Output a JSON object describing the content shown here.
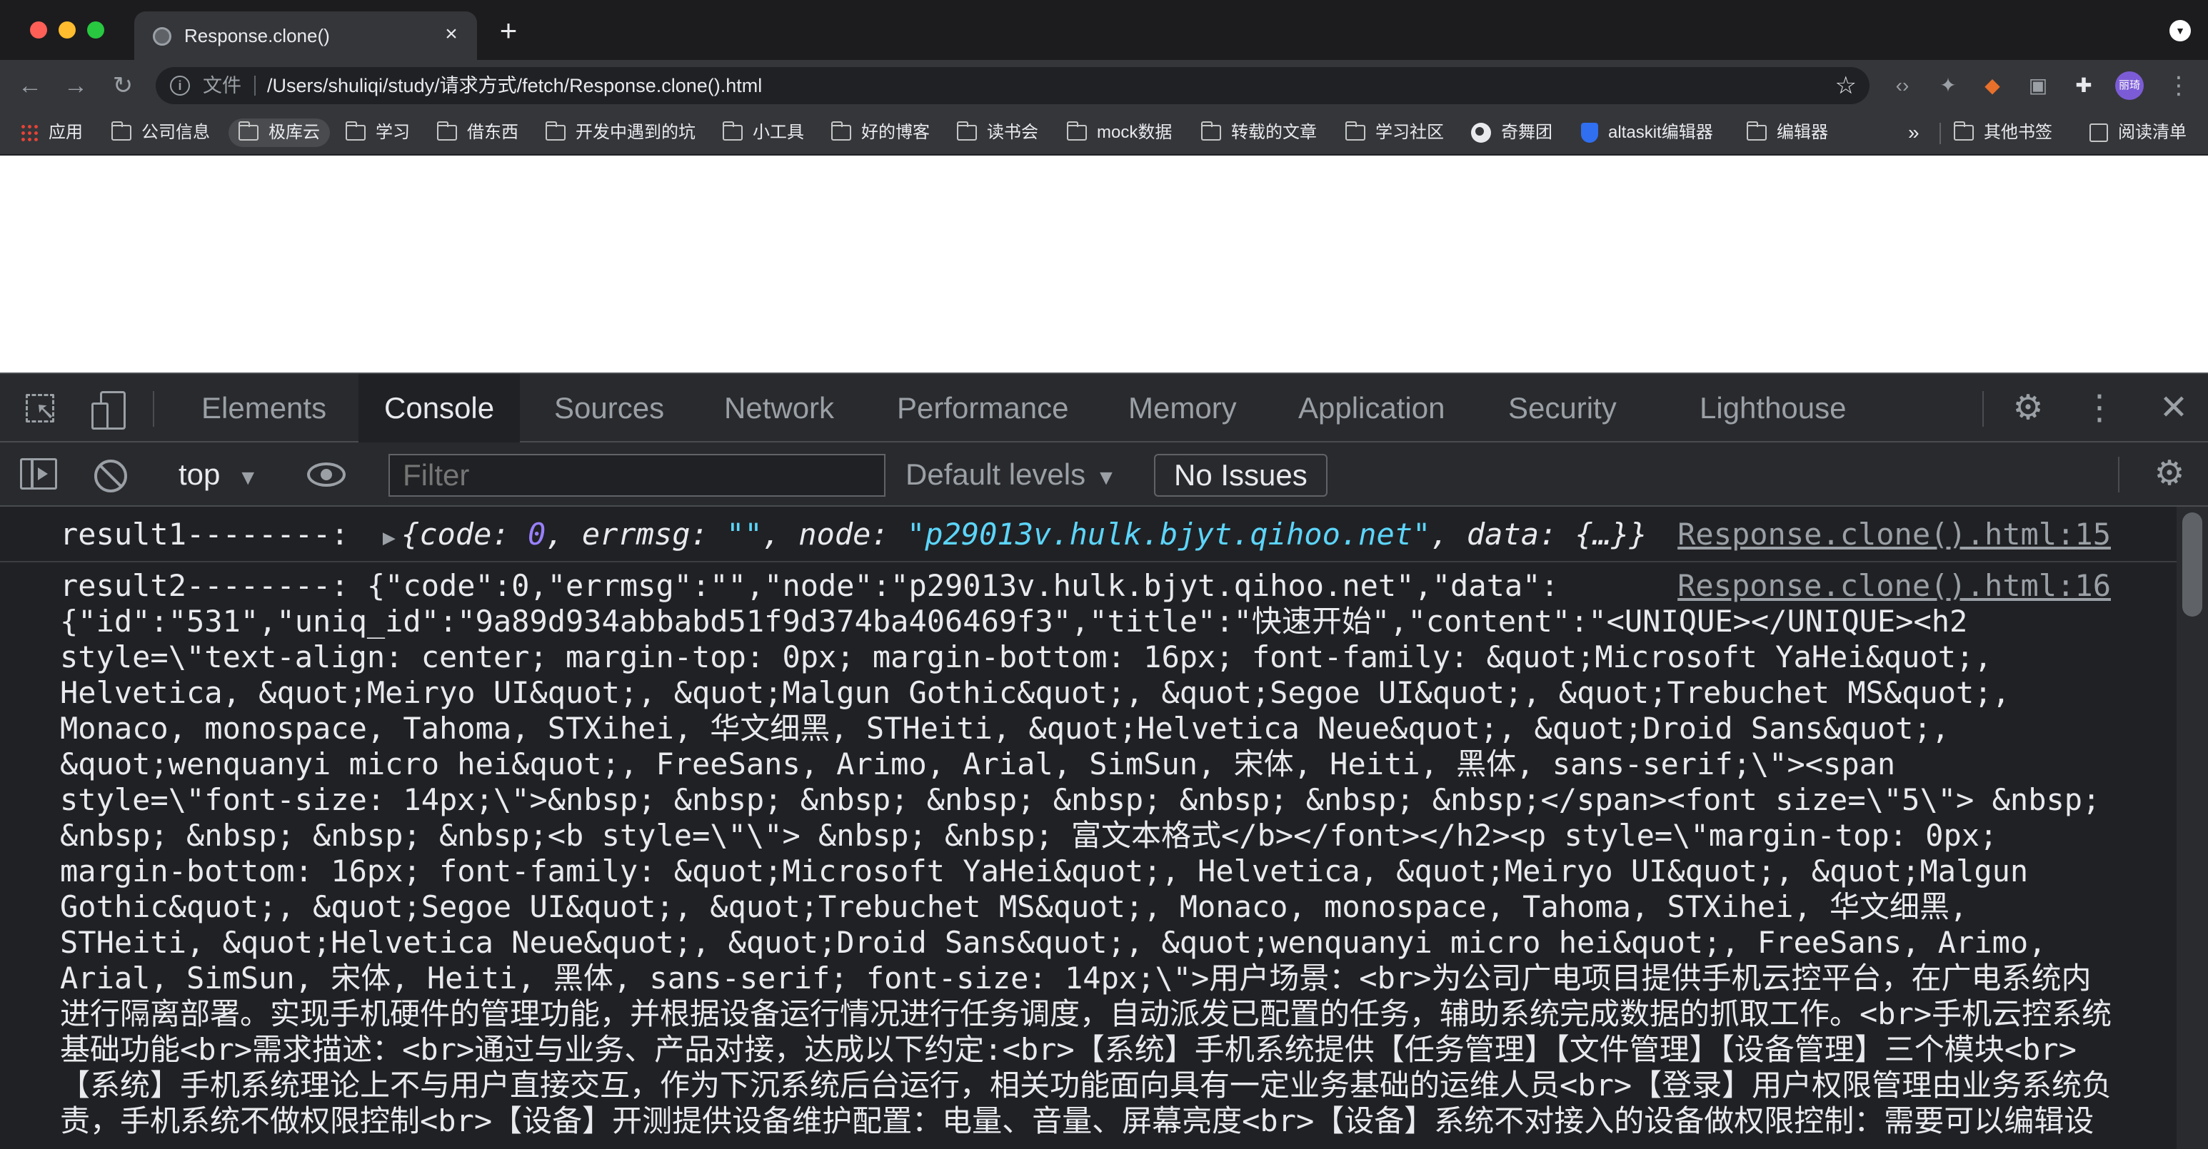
{
  "browser": {
    "tab_title": "Response.clone()",
    "omnibox_file_label": "文件",
    "url": "/Users/shuliqi/study/请求方式/fetch/Response.clone().html",
    "profile_initials": "丽琦"
  },
  "bookmarks": {
    "items": [
      {
        "label": "应用",
        "icon": "apps-grid-icon"
      },
      {
        "label": "公司信息",
        "icon": "folder-icon"
      },
      {
        "label": "极库云",
        "icon": "folder-icon"
      },
      {
        "label": "学习",
        "icon": "folder-icon"
      },
      {
        "label": "借东西",
        "icon": "folder-icon"
      },
      {
        "label": "开发中遇到的坑",
        "icon": "folder-icon"
      },
      {
        "label": "小工具",
        "icon": "folder-icon"
      },
      {
        "label": "好的博客",
        "icon": "folder-icon"
      },
      {
        "label": "读书会",
        "icon": "folder-icon"
      },
      {
        "label": "mock数据",
        "icon": "folder-icon"
      },
      {
        "label": "转载的文章",
        "icon": "folder-icon"
      },
      {
        "label": "学习社区",
        "icon": "folder-icon"
      },
      {
        "label": "奇舞团",
        "icon": "globe-icon"
      },
      {
        "label": "altaskit编辑器",
        "icon": "shield-icon"
      },
      {
        "label": "编辑器",
        "icon": "folder-icon"
      }
    ],
    "more": "»",
    "other_bookmarks": "其他书签",
    "reading_list": "阅读清单"
  },
  "devtools": {
    "tabs": [
      "Elements",
      "Console",
      "Sources",
      "Network",
      "Performance",
      "Memory",
      "Application",
      "Security",
      "Lighthouse"
    ],
    "active_tab": "Console",
    "context": "top",
    "filter_placeholder": "Filter",
    "levels": "Default levels",
    "issues": "No Issues"
  },
  "console": {
    "row1": {
      "label": "result1--------: ",
      "obj_open": "{",
      "code_key": "code: ",
      "code_val": "0",
      "errmsg_key": ", errmsg: ",
      "errmsg_val": "\"\"",
      "node_key": ", node: ",
      "node_val": "\"p29013v.hulk.bjyt.qihoo.net\"",
      "data_key": ", data: ",
      "data_val": "{…}}",
      "source": "Response.clone().html:15"
    },
    "row2": {
      "text": "result2--------: {\"code\":0,\"errmsg\":\"\",\"node\":\"p29013v.hulk.bjyt.qihoo.net\",\"data\":\n{\"id\":\"531\",\"uniq_id\":\"9a89d934abbabd51f9d374ba406469f3\",\"title\":\"快速开始\",\"content\":\"<UNIQUE></UNIQUE><h2\nstyle=\\\"text-align: center; margin-top: 0px; margin-bottom: 16px; font-family: &quot;Microsoft YaHei&quot;,\nHelvetica, &quot;Meiryo UI&quot;, &quot;Malgun Gothic&quot;, &quot;Segoe UI&quot;, &quot;Trebuchet MS&quot;,\nMonaco, monospace, Tahoma, STXihei, 华文细黑, STHeiti, &quot;Helvetica Neue&quot;, &quot;Droid Sans&quot;,\n&quot;wenquanyi micro hei&quot;, FreeSans, Arimo, Arial, SimSun, 宋体, Heiti, 黑体, sans-serif;\\\"><span\nstyle=\\\"font-size: 14px;\\\">&nbsp; &nbsp; &nbsp; &nbsp; &nbsp; &nbsp; &nbsp; &nbsp;</span><font size=\\\"5\\\"> &nbsp;\n&nbsp; &nbsp; &nbsp; &nbsp;<b style=\\\"\\\"> &nbsp; &nbsp; 富文本格式</b></font></h2><p style=\\\"margin-top: 0px;\nmargin-bottom: 16px; font-family: &quot;Microsoft YaHei&quot;, Helvetica, &quot;Meiryo UI&quot;, &quot;Malgun\nGothic&quot;, &quot;Segoe UI&quot;, &quot;Trebuchet MS&quot;, Monaco, monospace, Tahoma, STXihei, 华文细黑,\nSTHeiti, &quot;Helvetica Neue&quot;, &quot;Droid Sans&quot;, &quot;wenquanyi micro hei&quot;, FreeSans, Arimo,\nArial, SimSun, 宋体, Heiti, 黑体, sans-serif; font-size: 14px;\\\">用户场景：<br>为公司广电项目提供手机云控平台，在广电系统内\n进行隔离部署。实现手机硬件的管理功能，并根据设备运行情况进行任务调度，自动派发已配置的任务，辅助系统完成数据的抓取工作。<br>手机云控系统\n基础功能<br>需求描述：<br>通过与业务、产品对接，达成以下约定:<br>【系统】手机系统提供【任务管理】【文件管理】【设备管理】三个模块<br>\n【系统】手机系统理论上不与用户直接交互，作为下沉系统后台运行，相关功能面向具有一定业务基础的运维人员<br>【登录】用户权限管理由业务系统负\n责，手机系统不做权限控制<br>【设备】开测提供设备维护配置：电量、音量、屏幕亮度<br>【设备】系统不对接入的设备做权限控制：需要可以编辑设",
      "source": "Response.clone().html:16"
    }
  }
}
